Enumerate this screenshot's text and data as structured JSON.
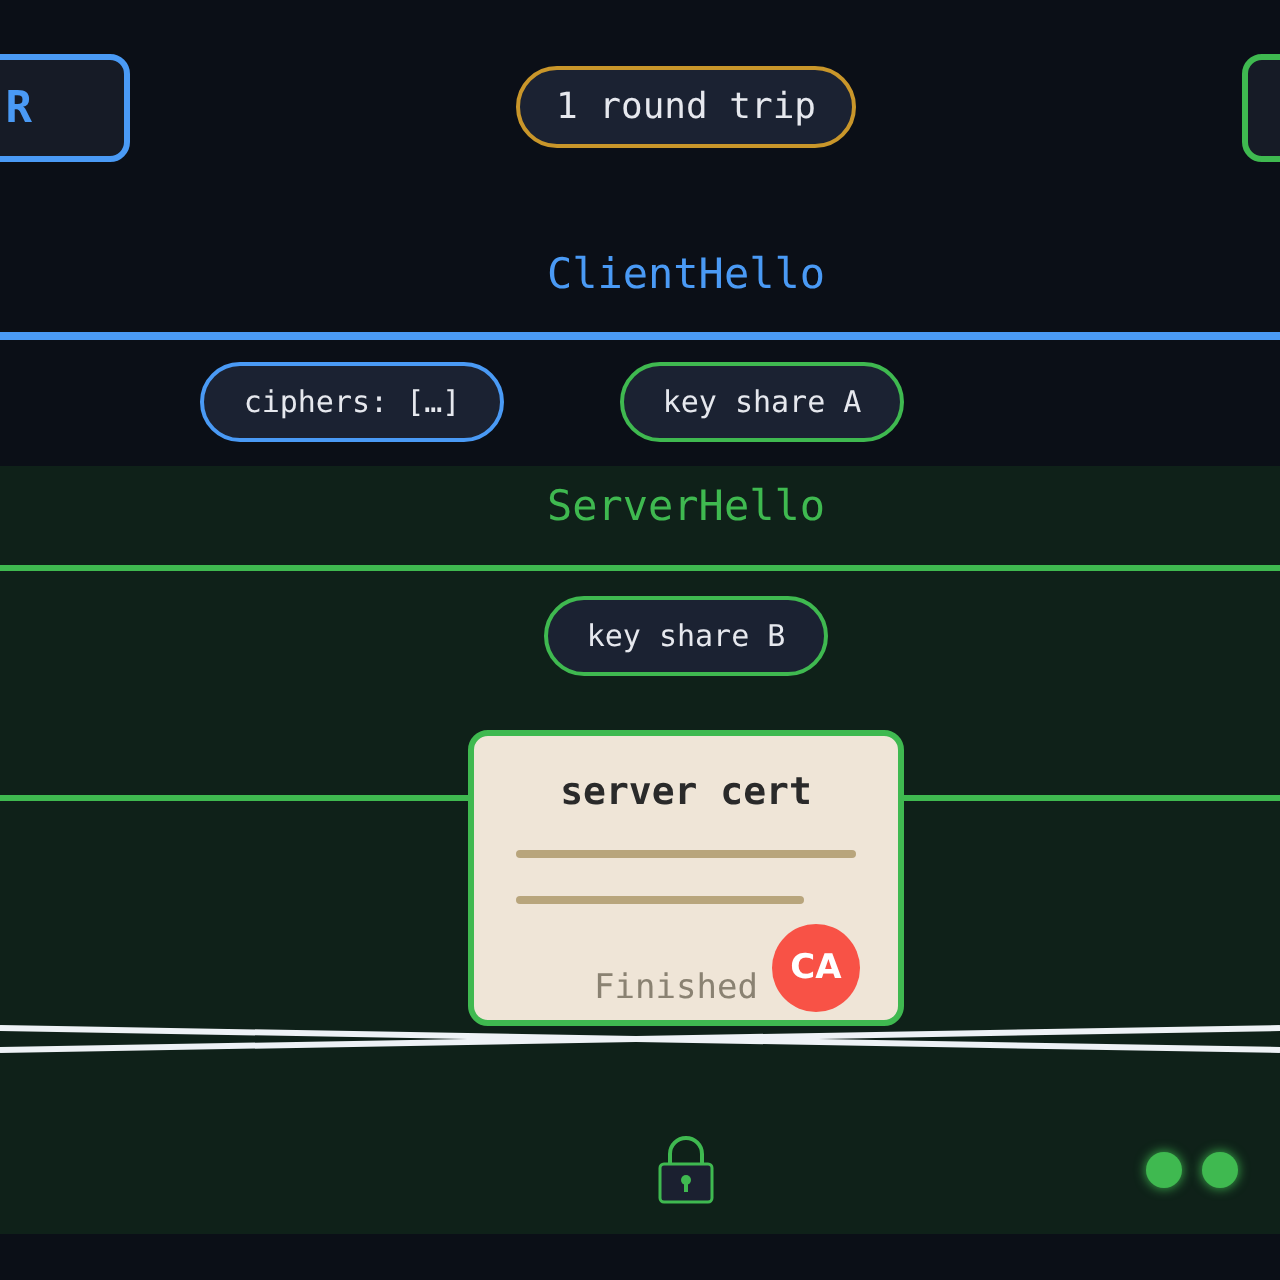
{
  "nodes": [
    {
      "label": "R",
      "color": "#4a9af5"
    },
    {
      "color": "#3fb950"
    }
  ],
  "round_trip_badge": {
    "label": "1 round trip"
  },
  "messages": [
    {
      "label": "ClientHello",
      "color": "#4a9af5",
      "fields": [
        {
          "label": "ciphers: […]",
          "color": "#4a9af5"
        },
        {
          "label": "key share A",
          "color": "#3fb950"
        }
      ]
    },
    {
      "label": "ServerHello",
      "color": "#3fb950",
      "fields": [
        {
          "label": "key share B",
          "color": "#3fb950"
        }
      ]
    }
  ],
  "certificate": {
    "title": "server cert",
    "badge": "CA"
  },
  "finished": {
    "label": "Finished"
  }
}
